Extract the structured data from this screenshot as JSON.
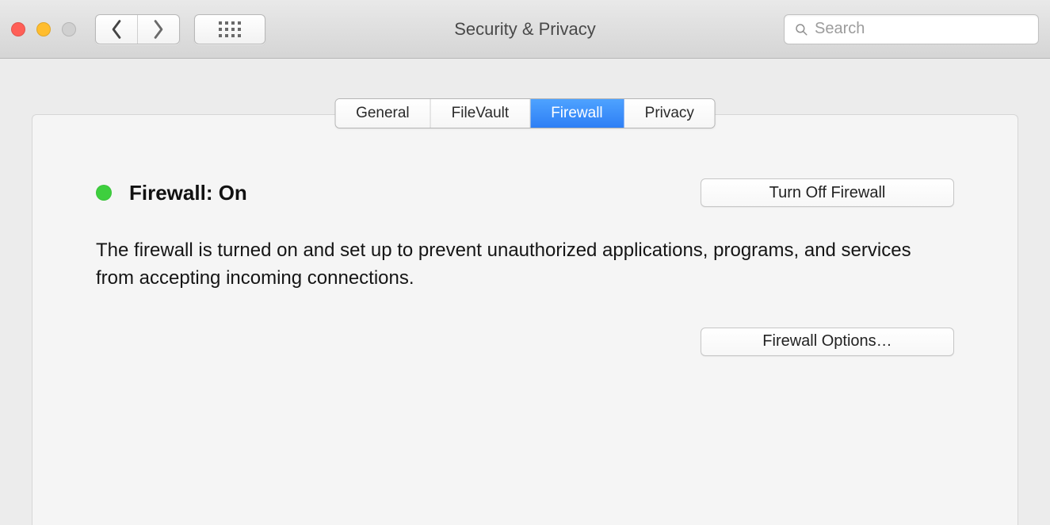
{
  "window": {
    "title": "Security & Privacy"
  },
  "search": {
    "placeholder": "Search"
  },
  "tabs": {
    "general": "General",
    "filevault": "FileVault",
    "firewall": "Firewall",
    "privacy": "Privacy",
    "active": "firewall"
  },
  "firewall": {
    "status_label": "Firewall: On",
    "status_color": "#3ecf3e",
    "toggle_label": "Turn Off Firewall",
    "description": "The firewall is turned on and set up to prevent unauthorized applications, programs, and services from accepting incoming connections.",
    "options_label": "Firewall Options…"
  }
}
